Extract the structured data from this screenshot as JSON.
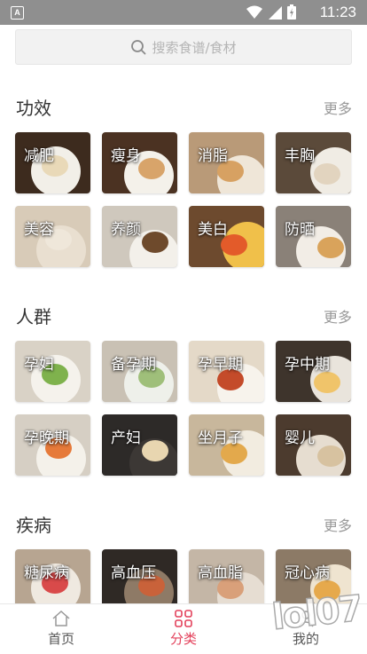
{
  "status": {
    "time": "11:23"
  },
  "search": {
    "placeholder": "搜索食谱/食材"
  },
  "sections": [
    {
      "title": "功效",
      "more": "更多",
      "items": [
        {
          "label": "减肥",
          "bg": "#3d2b1e",
          "accent": "#e9d9b8",
          "plate": "#f2efe8"
        },
        {
          "label": "瘦身",
          "bg": "#4b3222",
          "accent": "#d8a46a",
          "plate": "#f4f1ea"
        },
        {
          "label": "消脂",
          "bg": "#b99a78",
          "accent": "#d7a162",
          "plate": "#efe6d8"
        },
        {
          "label": "丰胸",
          "bg": "#5b4a3a",
          "accent": "#e2d4bf",
          "plate": "#f0ece4"
        },
        {
          "label": "美容",
          "bg": "#d8cbb8",
          "accent": "#efe7da",
          "plate": "#e9dfd0"
        },
        {
          "label": "养颜",
          "bg": "#cfc8bd",
          "accent": "#6e4a2c",
          "plate": "#f3f0ea"
        },
        {
          "label": "美白",
          "bg": "#6d4a2e",
          "accent": "#e35b2a",
          "plate": "#f0c04a"
        },
        {
          "label": "防晒",
          "bg": "#8a8178",
          "accent": "#d9a35b",
          "plate": "#f2ede6"
        }
      ]
    },
    {
      "title": "人群",
      "more": "更多",
      "items": [
        {
          "label": "孕妇",
          "bg": "#d9d2c6",
          "accent": "#7fb24d",
          "plate": "#f5f2ec"
        },
        {
          "label": "备孕期",
          "bg": "#c9c1b4",
          "accent": "#9fbf7a",
          "plate": "#eef0ea"
        },
        {
          "label": "孕早期",
          "bg": "#e4d9c8",
          "accent": "#c44b2a",
          "plate": "#f7f3ec"
        },
        {
          "label": "孕中期",
          "bg": "#3e342c",
          "accent": "#f0c46a",
          "plate": "#e9e4dc"
        },
        {
          "label": "孕晚期",
          "bg": "#d6cfc4",
          "accent": "#e67a3a",
          "plate": "#f4f1ea"
        },
        {
          "label": "产妇",
          "bg": "#2d2a28",
          "accent": "#e8d6b0",
          "plate": "#3c3835"
        },
        {
          "label": "坐月子",
          "bg": "#c8b79c",
          "accent": "#e3a94c",
          "plate": "#f2ece0"
        },
        {
          "label": "婴儿",
          "bg": "#4c3b2e",
          "accent": "#d7c2a0",
          "plate": "#e6ddd0"
        }
      ]
    },
    {
      "title": "疾病",
      "more": "更多",
      "items": [
        {
          "label": "糖尿病",
          "bg": "#b7a591",
          "accent": "#d94a4a",
          "plate": "#efe9e0"
        },
        {
          "label": "高血压",
          "bg": "#2f2925",
          "accent": "#c9623a",
          "plate": "#8e7a66"
        },
        {
          "label": "高血脂",
          "bg": "#c4b6a6",
          "accent": "#d9a07a",
          "plate": "#e6ddd2"
        },
        {
          "label": "冠心病",
          "bg": "#8c7a66",
          "accent": "#e6a94c",
          "plate": "#efe4d0"
        }
      ]
    }
  ],
  "tabs": [
    {
      "label": "首页",
      "icon": "home-icon",
      "active": false
    },
    {
      "label": "分类",
      "icon": "grid-icon",
      "active": true
    },
    {
      "label": "我的",
      "icon": "user-icon",
      "active": false
    }
  ],
  "watermark": "lol07",
  "colors": {
    "accent": "#e3415b",
    "more": "#999999"
  }
}
